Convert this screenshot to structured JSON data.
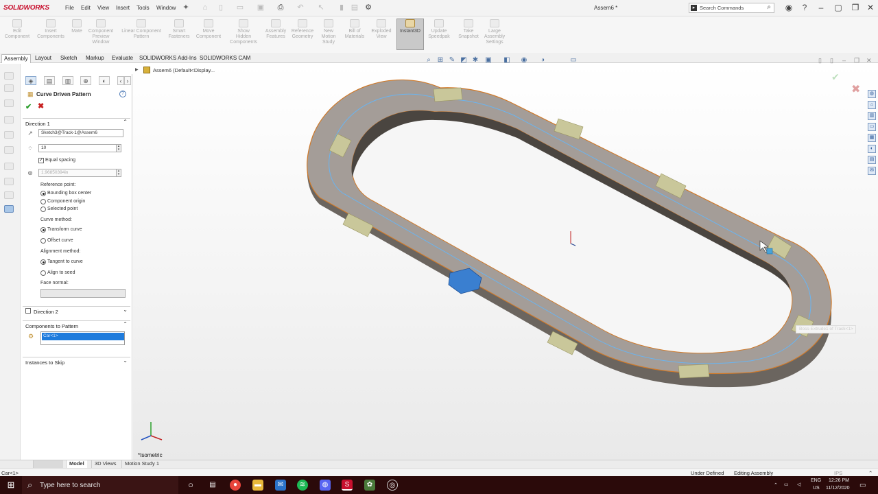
{
  "app": {
    "brand": "SOLIDWORKS",
    "doc_title": "Assem6 *"
  },
  "menu": [
    "File",
    "Edit",
    "View",
    "Insert",
    "Tools",
    "Window"
  ],
  "search": {
    "placeholder": "Search Commands"
  },
  "ribbon": [
    {
      "label": "Edit\nComponent"
    },
    {
      "label": "Insert\nComponents"
    },
    {
      "label": "Mate"
    },
    {
      "label": "Component\nPreview\nWindow"
    },
    {
      "label": "Linear Component\nPattern"
    },
    {
      "label": "Smart\nFasteners"
    },
    {
      "label": "Move\nComponent"
    },
    {
      "label": "Show\nHidden\nComponents"
    },
    {
      "label": "Assembly\nFeatures"
    },
    {
      "label": "Reference\nGeometry"
    },
    {
      "label": "New\nMotion\nStudy"
    },
    {
      "label": "Bill of\nMaterials"
    },
    {
      "label": "Exploded\nView"
    },
    {
      "label": "Instant3D"
    },
    {
      "label": "Update\nSpeedpak"
    },
    {
      "label": "Take\nSnapshot"
    },
    {
      "label": "Large\nAssembly\nSettings"
    }
  ],
  "cm_tabs": [
    "Assembly",
    "Layout",
    "Sketch",
    "Markup",
    "Evaluate",
    "SOLIDWORKS Add-Ins",
    "SOLIDWORKS CAM"
  ],
  "tree": {
    "root": "Assem6  (Default<Display..."
  },
  "pm": {
    "title": "Curve Driven Pattern",
    "direction1": {
      "label": "Direction 1",
      "curve": "Sketch3@Track-1@Assem6",
      "instances": "10",
      "equal_spacing": "Equal spacing",
      "spacing": "1.96850394in",
      "reference_point_label": "Reference point:",
      "ref_options": [
        "Bounding box center",
        "Component origin",
        "Selected point"
      ],
      "curve_method_label": "Curve method:",
      "curve_options": [
        "Transform curve",
        "Offset curve"
      ],
      "alignment_label": "Alignment method:",
      "alignment_options": [
        "Tangent to curve",
        "Align to seed"
      ],
      "face_normal_label": "Face normal:"
    },
    "direction2": {
      "label": "Direction 2"
    },
    "components": {
      "label": "Components to Pattern",
      "item": "Car<1>"
    },
    "skip": {
      "label": "Instances to Skip"
    }
  },
  "viewport": {
    "view_label": "*Isometric",
    "hover_tooltip": "Boss-Extrude1 of Track<1>"
  },
  "bottom_tabs": [
    "Model",
    "3D Views",
    "Motion Study 1"
  ],
  "status": {
    "left": "Car<1>",
    "defined": "Under Defined",
    "mode": "Editing Assembly",
    "units": "IPS"
  },
  "taskbar": {
    "search_placeholder": "Type here to search",
    "lang1": "ENG",
    "lang2": "US",
    "time": "12:26 PM",
    "date": "11/12/2020"
  },
  "colors": {
    "brand": "#c8102e",
    "track": "#a49d98",
    "edge": "#d07a2a",
    "car": "#c9c79a",
    "seed_car": "#3a7fd0"
  }
}
